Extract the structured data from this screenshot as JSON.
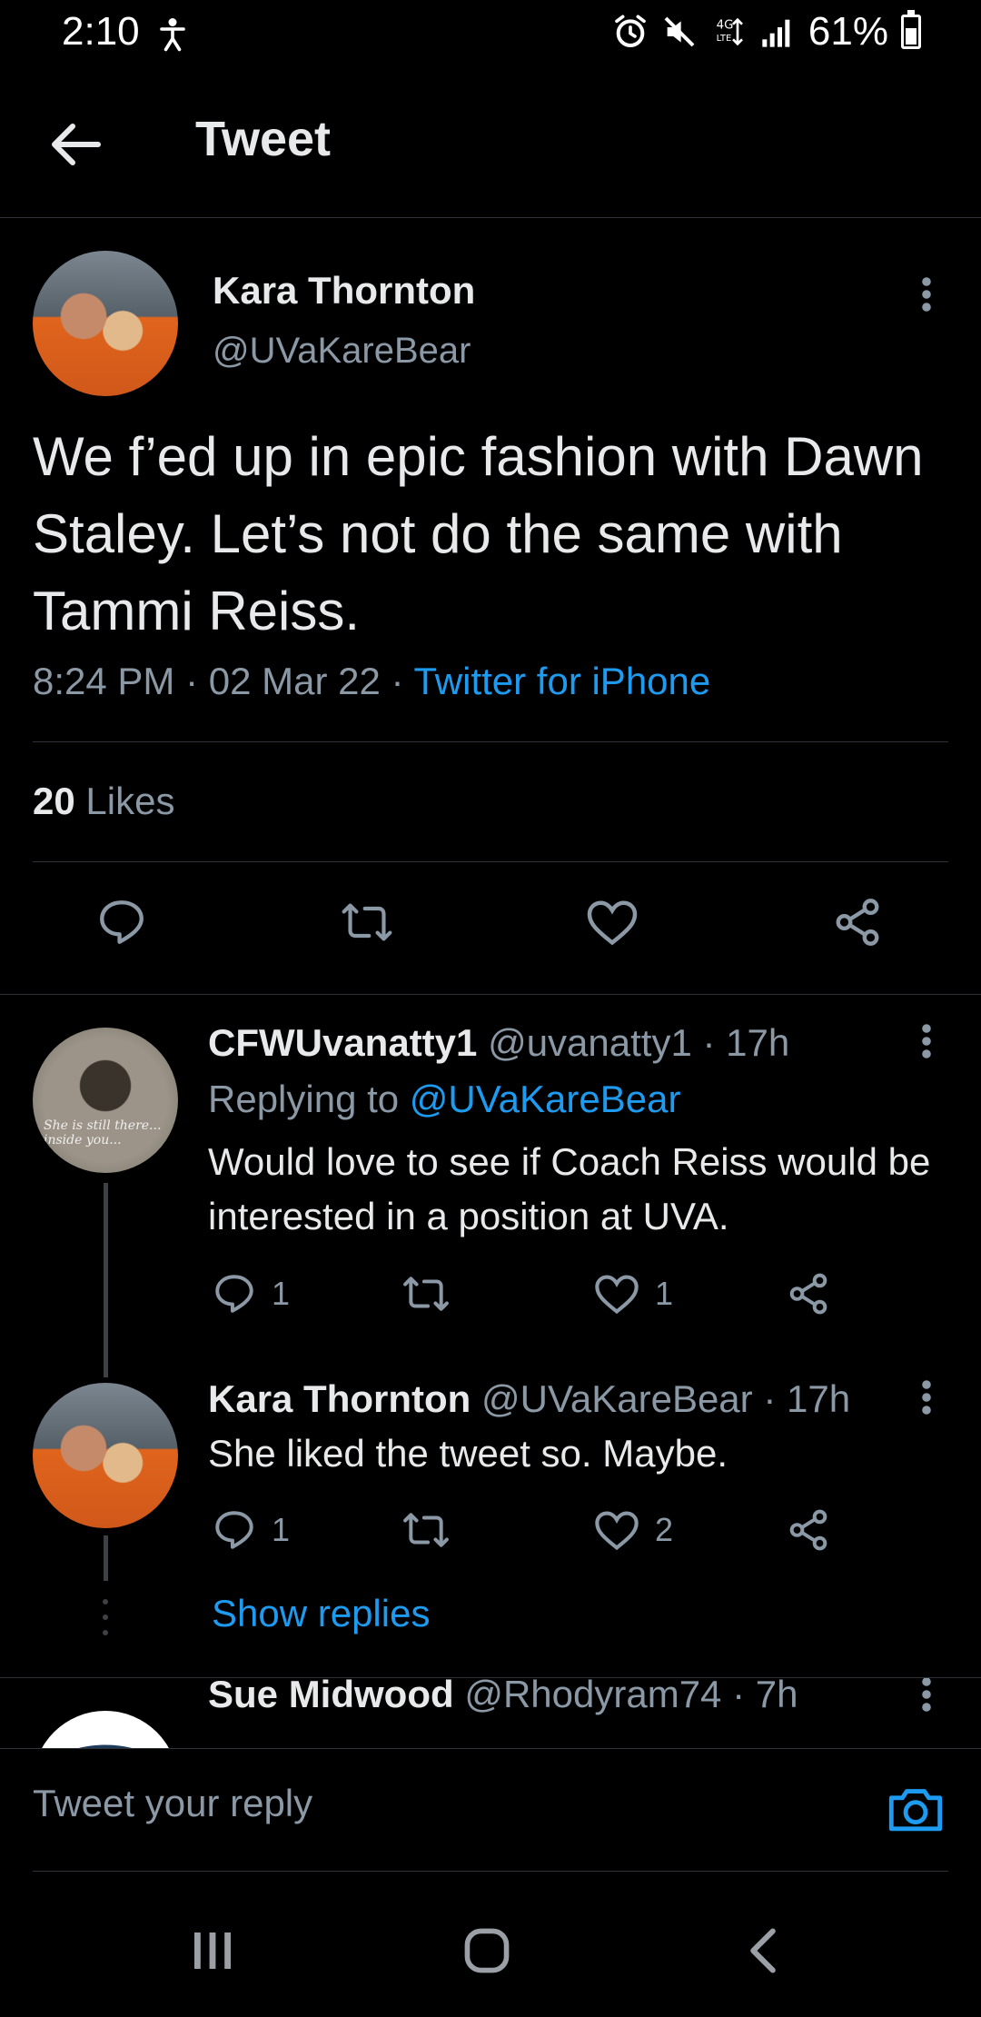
{
  "status_bar": {
    "time": "2:10",
    "battery": "61%",
    "icons": [
      "alarm-icon",
      "mute-icon",
      "lte-icon",
      "signal-icon",
      "battery-icon"
    ]
  },
  "header": {
    "title": "Tweet"
  },
  "main_tweet": {
    "author_name": "Kara Thornton",
    "author_handle": "@UVaKareBear",
    "text": "We f’ed up in epic fashion with Dawn Staley. Let’s not do the same with Tammi Reiss.",
    "time": "8:24 PM",
    "date": "02 Mar 22",
    "source": "Twitter for iPhone",
    "likes_count": "20",
    "likes_label": "Likes"
  },
  "replies": [
    {
      "name": "CFWUvanatty1",
      "handle": "@uvanatty1",
      "age": "17h",
      "replying_label": "Replying to",
      "replying_to": "@UVaKareBear",
      "text": "Would love to see if Coach Reiss would be interested in a position at UVA.",
      "avatar_text": "She is still there... inside you...",
      "reply_count": "1",
      "like_count": "1"
    },
    {
      "name": "Kara Thornton",
      "handle": "@UVaKareBear",
      "age": "17h",
      "text": "She liked the tweet so. Maybe.",
      "reply_count": "1",
      "like_count": "2"
    },
    {
      "name": "Sue Midwood",
      "handle": "@Rhodyram74",
      "age": "7h"
    }
  ],
  "show_replies_label": "Show replies",
  "composer": {
    "placeholder": "Tweet your reply"
  },
  "colors": {
    "background": "#000000",
    "accent": "#1d9bf0",
    "secondary_text": "#8b98a5",
    "divider": "#2f3336"
  }
}
